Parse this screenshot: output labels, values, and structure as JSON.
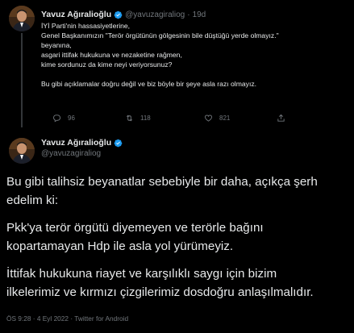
{
  "tweet1": {
    "author_name": "Yavuz Ağıralioğlu",
    "author_handle": "@yavuzagiraliog",
    "separator": "·",
    "time": "19d",
    "lines": [
      "İYİ Parti'nin hassasiyetlerine,",
      "Genel Başkanımızın \"Terör örgütünün gölgesinin bile düştüğü yerde olmayız.\"",
      "beyanına,",
      "asgari ittifak hukukuna ve nezaketine rağmen,",
      "kime sordunuz da kime neyi veriyorsunuz?"
    ],
    "last_line": "Bu gibi açıklamalar doğru değil ve biz böyle bir şeye asla razı olmayız.",
    "stats": {
      "replies": "96",
      "retweets": "118",
      "likes": "821"
    },
    "icons": [
      "reply-icon",
      "retweet-icon",
      "like-icon",
      "share-icon"
    ]
  },
  "tweet2": {
    "author_name": "Yavuz Ağıralioğlu",
    "author_handle": "@yavuzagiraliog",
    "paragraphs": [
      [
        "Bu gibi talihsiz beyanatlar sebebiyle bir daha, açıkça şerh",
        "edelim ki:"
      ],
      [
        "Pkk'ya terör örgütü diyemeyen ve terörle bağını",
        "kopartamayan Hdp ile asla yol yürümeyiz."
      ],
      [
        "İttifak hukukuna riayet ve karşılıklı saygı için bizim",
        "ilkelerimiz ve kırmızı çizgilerimiz dosdoğru anlaşılmalıdır."
      ]
    ],
    "footer": "ÖS 9:28 · 4 Eyl 2022 · Twitter for Android"
  },
  "colors": {
    "background": "#000000",
    "text": "#e7e9ea",
    "muted": "#71767b",
    "verified": "#1d9bf0",
    "divider": "#333639"
  }
}
